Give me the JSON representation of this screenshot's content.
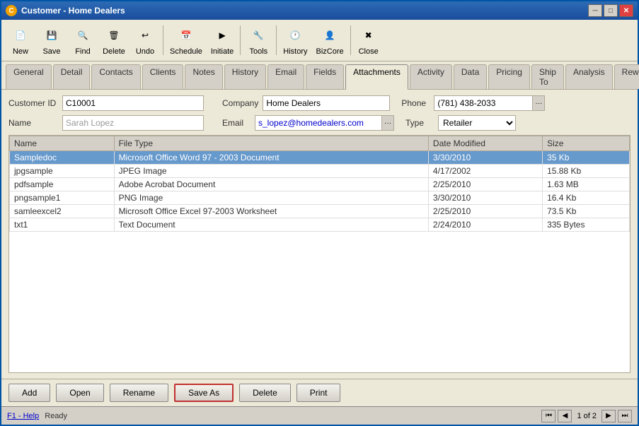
{
  "window": {
    "title": "Customer - Home Dealers",
    "min_btn": "─",
    "max_btn": "□",
    "close_btn": "✕"
  },
  "toolbar": {
    "buttons": [
      {
        "id": "new",
        "label": "New",
        "icon": "📄"
      },
      {
        "id": "save",
        "label": "Save",
        "icon": "💾"
      },
      {
        "id": "find",
        "label": "Find",
        "icon": "🔍"
      },
      {
        "id": "delete",
        "label": "Delete",
        "icon": "🗑"
      },
      {
        "id": "undo",
        "label": "Undo",
        "icon": "↩"
      },
      {
        "id": "schedule",
        "label": "Schedule",
        "icon": "📅"
      },
      {
        "id": "initiate",
        "label": "Initiate",
        "icon": "▶"
      },
      {
        "id": "tools",
        "label": "Tools",
        "icon": "🔧"
      },
      {
        "id": "history",
        "label": "History",
        "icon": "🕐"
      },
      {
        "id": "bizcore",
        "label": "BizCore",
        "icon": "👤"
      },
      {
        "id": "close",
        "label": "Close",
        "icon": "✖"
      }
    ]
  },
  "tabs": [
    {
      "id": "general",
      "label": "General"
    },
    {
      "id": "detail",
      "label": "Detail"
    },
    {
      "id": "contacts",
      "label": "Contacts"
    },
    {
      "id": "clients",
      "label": "Clients"
    },
    {
      "id": "notes",
      "label": "Notes"
    },
    {
      "id": "history",
      "label": "History"
    },
    {
      "id": "email",
      "label": "Email"
    },
    {
      "id": "fields",
      "label": "Fields"
    },
    {
      "id": "attachments",
      "label": "Attachments",
      "active": true
    },
    {
      "id": "activity",
      "label": "Activity"
    },
    {
      "id": "data",
      "label": "Data"
    },
    {
      "id": "pricing",
      "label": "Pricing"
    },
    {
      "id": "ship-to",
      "label": "Ship To"
    },
    {
      "id": "analysis",
      "label": "Analysis"
    },
    {
      "id": "rewards",
      "label": "Rewards"
    }
  ],
  "form": {
    "customer_id_label": "Customer ID",
    "customer_id_value": "C10001",
    "name_label": "Name",
    "name_value": "Sarah Lopez",
    "company_label": "Company",
    "company_value": "Home Dealers",
    "email_label": "Email",
    "email_value": "s_lopez@homedealers.com",
    "phone_label": "Phone",
    "phone_value": "(781) 438-2033",
    "type_label": "Type",
    "type_value": "Retailer"
  },
  "table": {
    "columns": [
      "Name",
      "File Type",
      "Date Modified",
      "Size"
    ],
    "rows": [
      {
        "name": "Sampledoc",
        "file_type": "Microsoft Office Word 97 - 2003 Document",
        "date_modified": "3/30/2010",
        "size": "35 Kb",
        "selected": true
      },
      {
        "name": "jpgsample",
        "file_type": "JPEG Image",
        "date_modified": "4/17/2002",
        "size": "15.88 Kb",
        "selected": false
      },
      {
        "name": "pdfsample",
        "file_type": "Adobe Acrobat Document",
        "date_modified": "2/25/2010",
        "size": "1.63 MB",
        "selected": false
      },
      {
        "name": "pngsample1",
        "file_type": "PNG Image",
        "date_modified": "3/30/2010",
        "size": "16.4 Kb",
        "selected": false
      },
      {
        "name": "samleexcel2",
        "file_type": "Microsoft Office Excel 97-2003 Worksheet",
        "date_modified": "2/25/2010",
        "size": "73.5 Kb",
        "selected": false
      },
      {
        "name": "txt1",
        "file_type": "Text Document",
        "date_modified": "2/24/2010",
        "size": "335 Bytes",
        "selected": false
      }
    ]
  },
  "bottom_buttons": [
    {
      "id": "add",
      "label": "Add"
    },
    {
      "id": "open",
      "label": "Open"
    },
    {
      "id": "rename",
      "label": "Rename"
    },
    {
      "id": "save-as",
      "label": "Save As",
      "highlighted": true
    },
    {
      "id": "delete",
      "label": "Delete"
    },
    {
      "id": "print",
      "label": "Print"
    }
  ],
  "status": {
    "help": "F1 - Help",
    "ready": "Ready",
    "page": "1",
    "of": "of",
    "total_pages": "2"
  }
}
